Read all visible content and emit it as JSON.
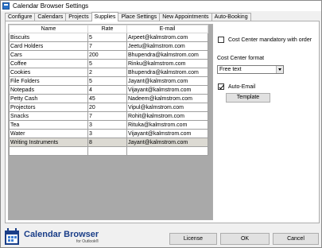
{
  "window": {
    "title": "Calendar Browser Settings"
  },
  "tabs": [
    {
      "label": "Configure",
      "active": false
    },
    {
      "label": "Calendars",
      "active": false
    },
    {
      "label": "Projects",
      "active": false
    },
    {
      "label": "Supplies",
      "active": true
    },
    {
      "label": "Place Settings",
      "active": false
    },
    {
      "label": "New Appointments",
      "active": false
    },
    {
      "label": "Auto-Booking",
      "active": false
    }
  ],
  "grid": {
    "columns": [
      "Name",
      "Rate",
      "E-mail"
    ],
    "rows": [
      {
        "name": "Biscuits",
        "rate": "5",
        "email": "Arpeet@kalmstrom.com"
      },
      {
        "name": "Card Holders",
        "rate": "7",
        "email": "Jeetu@kalmstrom.com"
      },
      {
        "name": "Cars",
        "rate": "200",
        "email": "Bhupendra@kalmstrom.com"
      },
      {
        "name": "Coffee",
        "rate": "5",
        "email": "Rinku@kalmstrom.com"
      },
      {
        "name": "Cookies",
        "rate": "2",
        "email": "Bhupendra@kalmstrom.com"
      },
      {
        "name": "File Folders",
        "rate": "5",
        "email": "Jayant@kalmstrom.com"
      },
      {
        "name": "Notepads",
        "rate": "4",
        "email": "Vijayant@kalmstrom.com"
      },
      {
        "name": "Petty Cash",
        "rate": "45",
        "email": "Nadeem@kalmstrom.com"
      },
      {
        "name": "Projectors",
        "rate": "20",
        "email": "Vipul@kalmstrom.com"
      },
      {
        "name": "Snacks",
        "rate": "7",
        "email": "Rohit@kalmstrom.com"
      },
      {
        "name": "Tea",
        "rate": "3",
        "email": "Rituka@kalmstrom.com"
      },
      {
        "name": "Water",
        "rate": "3",
        "email": "Vijayant@kalmstrom.com"
      },
      {
        "name": "Writing Instruments",
        "rate": "8",
        "email": "Jayant@kalmstrom.com",
        "selected": true
      }
    ]
  },
  "options": {
    "cost_center_mandatory_label": "Cost Center mandatory with order",
    "cost_center_mandatory_checked": false,
    "cost_center_format_label": "Cost Center format",
    "cost_center_format_value": "Free text",
    "auto_email_label": "Auto-Email",
    "auto_email_checked": true,
    "template_button": "Template"
  },
  "footer": {
    "logo_main_1": "Calendar",
    "logo_main_2": "Browser",
    "logo_sub": "for Outlook®",
    "license_button": "License",
    "ok_button": "OK",
    "cancel_button": "Cancel"
  },
  "colors": {
    "window_bg": "#f0f0f0",
    "selected_row": "#dcdad3",
    "grid_empty_area": "#a9a9a9",
    "logo_blue": "#1a3e88"
  }
}
